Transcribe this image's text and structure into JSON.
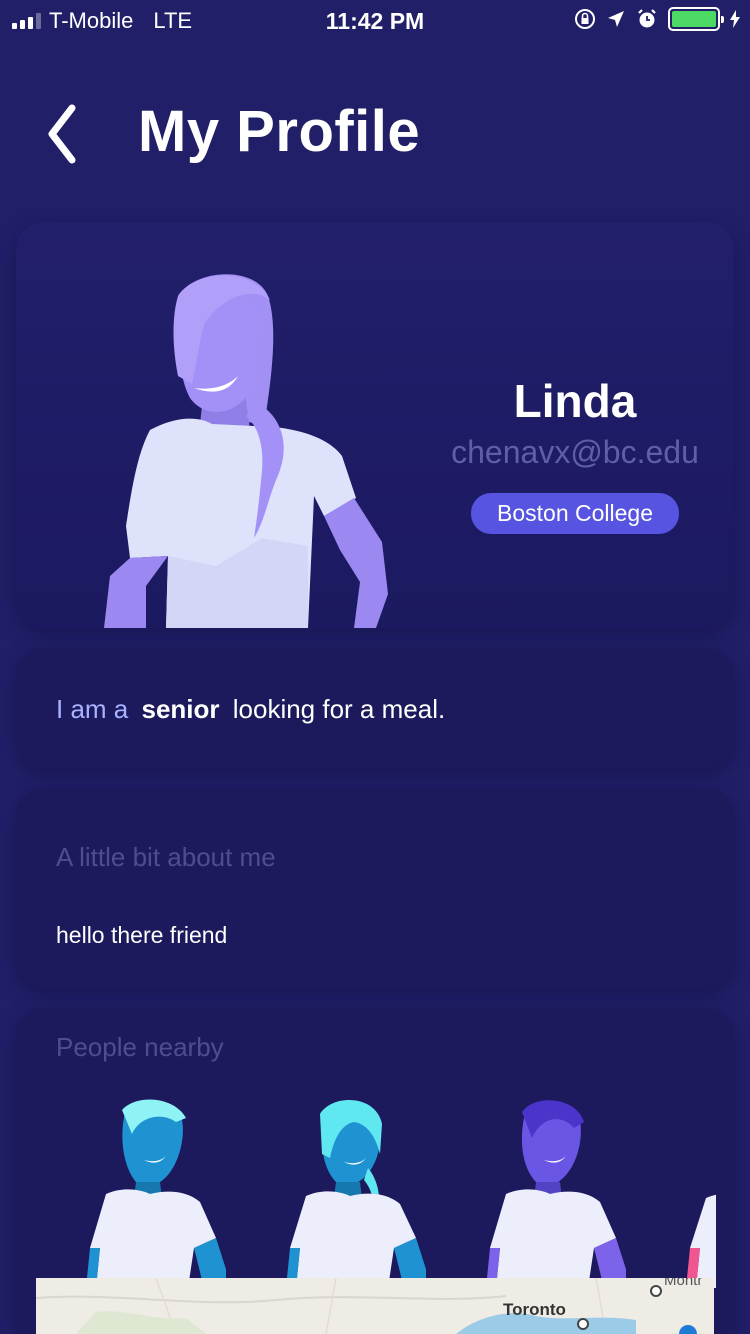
{
  "status_bar": {
    "carrier": "T-Mobile",
    "network": "LTE",
    "time": "11:42 PM",
    "battery_color": "#4cd964"
  },
  "header": {
    "back_icon": "chevron-left-icon",
    "title": "My Profile"
  },
  "profile": {
    "name": "Linda",
    "email": "chenavx@bc.edu",
    "school": "Boston College",
    "avatar_color": "#a391f7"
  },
  "status": {
    "prefix": "I am a",
    "year": "senior",
    "suffix": "looking for a meal."
  },
  "about": {
    "title": "A little bit about me",
    "text": "hello there friend"
  },
  "nearby": {
    "title": "People nearby",
    "people_colors": [
      "#1f93d1",
      "#1f93d1",
      "#5a47d6",
      "#d91e63"
    ]
  },
  "map": {
    "label": "Toronto",
    "label_2": "Montr"
  },
  "colors": {
    "background": "#211f68",
    "card": "#1c1a5c",
    "accent": "#5654e0",
    "muted_text": "#4d4d8f"
  }
}
